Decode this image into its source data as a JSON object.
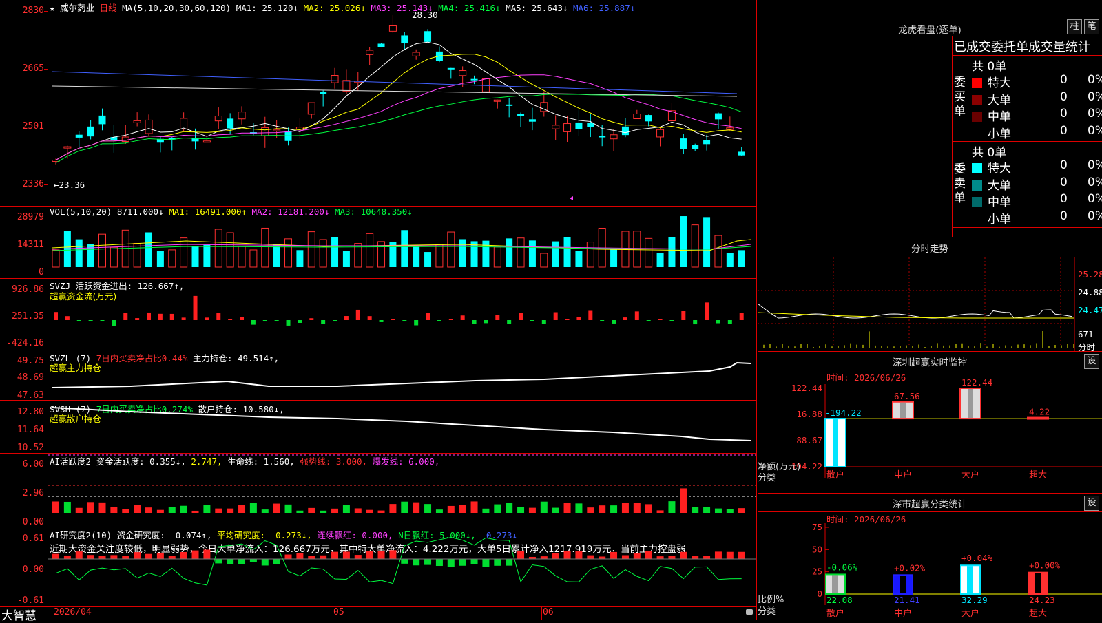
{
  "app": {
    "brand": "大智慧"
  },
  "main": {
    "star": "★",
    "stock_name": "威尔药业",
    "period": "日线",
    "ma_label": "MA(5,10,20,30,60,120)",
    "ma1": "MA1: 25.120↓",
    "ma2": "MA2: 25.026↓",
    "ma3": "MA3: 25.143↓",
    "ma4": "MA4: 25.416↓",
    "ma5": "MA5: 25.643↓",
    "ma6": "MA6: 25.887↓",
    "high_mark": "28.30",
    "low_mark": "←23.36",
    "y_labels": [
      "2830",
      "2665",
      "2501",
      "2336"
    ]
  },
  "vol": {
    "header_a": "VOL(5,10,20)",
    "val": "8711.000↓",
    "ma1": "MA1: 16491.000↑",
    "ma2": "MA2: 12181.200↓",
    "ma3": "MA3: 10648.350↓",
    "y_labels": [
      "28979",
      "14311",
      "0"
    ]
  },
  "svzj": {
    "header": "SVZJ  活跃资金进出: 126.667↑,",
    "sub": "超赢资金流(万元)",
    "y_labels": [
      "926.86",
      "251.35",
      "-424.16"
    ]
  },
  "svzl": {
    "header_a": "SVZL (7)",
    "header_b": "7日内买卖净占比0.44%",
    "header_c": "主力持仓: 49.514↑,",
    "sub": "超赢主力持仓",
    "y_labels": [
      "49.75",
      "48.69",
      "47.63"
    ]
  },
  "svsh": {
    "header_a": "SVSH (7)",
    "header_b": "7日内买卖净占比0.274%",
    "header_c": "散户持仓: 10.580↓,",
    "sub": "超赢散户持仓",
    "y_labels": [
      "12.80",
      "11.64",
      "10.52"
    ]
  },
  "ai_active": {
    "h1": "AI活跃度2",
    "h2": "资金活跃度: 0.355↓,",
    "h3": "2.747,",
    "h4": "生命线: 1.560,",
    "h5": "强势线: 3.000,",
    "h6": "爆发线: 6.000,",
    "y_labels": [
      "6.00",
      "2.96",
      "0.00"
    ]
  },
  "ai_research": {
    "h1": "AI研究度2(10)",
    "h2": "资金研究度: -0.074↑,",
    "h3": "平均研究度: -0.273↓,",
    "h4": "连续飘红: 0.000,",
    "h5": "N日飘红: 5.000↓,",
    "h6": "-0.273↓",
    "summary": "近期大资金关注度较低，明显弱势，今日大单净流入：126.667万元，其中特大单净流入：4.222万元，大单5日累计净入1217.919万元，当前主力控盘弱",
    "y_labels": [
      "0.61",
      "0.00",
      "-0.61"
    ]
  },
  "dates": [
    "2026/04",
    "05",
    "06"
  ],
  "longhu": {
    "title": "龙虎看盘(逐单)",
    "btn_bar": "柱",
    "btn_pen": "笔",
    "subtitle": "已成交委托单成交量统计",
    "buy_label": "委买单",
    "sell_label": "委卖单",
    "buy_total": "共 0单",
    "sell_total": "共 0单",
    "buy_rows": [
      {
        "name": "特大",
        "n": "0",
        "p": "0%",
        "color": "#ff0000"
      },
      {
        "name": "大单",
        "n": "0",
        "p": "0%",
        "color": "#8b0000"
      },
      {
        "name": "中单",
        "n": "0",
        "p": "0%",
        "color": "#6a0000"
      },
      {
        "name": "小单",
        "n": "0",
        "p": "0%",
        "color": "#000000"
      }
    ],
    "sell_rows": [
      {
        "name": "特大",
        "n": "0",
        "p": "0%",
        "color": "#00ffff"
      },
      {
        "name": "大单",
        "n": "0",
        "p": "0%",
        "color": "#008b8b"
      },
      {
        "name": "中单",
        "n": "0",
        "p": "0%",
        "color": "#006a6a"
      },
      {
        "name": "小单",
        "n": "0",
        "p": "0%",
        "color": "#000000"
      }
    ]
  },
  "intraday": {
    "title": "分时走势",
    "y_labels": [
      "25.28",
      "24.88",
      "24.47",
      "671",
      "分时"
    ]
  },
  "sz_monitor": {
    "title": "深圳超赢实时监控",
    "btn": "设",
    "time": "时间: 2026/06/26",
    "y_labels": [
      "122.44",
      "16.88",
      "-88.67",
      "-194.22"
    ],
    "axis_a": "净额(万元)",
    "axis_b": "分类",
    "categories": [
      "散户",
      "中户",
      "大户",
      "超大"
    ],
    "values": [
      -194.22,
      67.56,
      122.44,
      4.22
    ],
    "value_labels": [
      "-194.22",
      "67.56",
      "122.44",
      "4.22"
    ]
  },
  "sz_class": {
    "title": "深市超赢分类统计",
    "btn": "设",
    "time": "时间: 2026/06/26",
    "y_labels": [
      "75",
      "50",
      "25",
      "0"
    ],
    "axis_a": "比例%",
    "axis_b": "分类",
    "categories": [
      "散户",
      "中户",
      "大户",
      "超大"
    ],
    "values": [
      22.08,
      21.41,
      32.29,
      24.23
    ],
    "change_labels": [
      "-0.06%",
      "+0.02%",
      "+0.04%",
      "+0.00%"
    ],
    "value_labels": [
      "22.08",
      "21.41",
      "32.29",
      "24.23"
    ]
  }
}
